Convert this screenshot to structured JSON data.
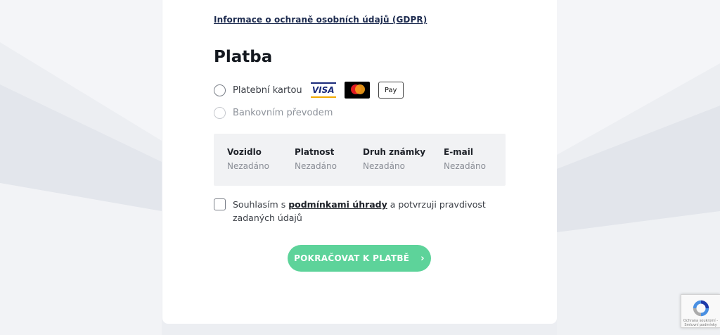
{
  "gdpr_link": "Informace o ochraně osobních údajů (GDPR)",
  "payment": {
    "title": "Platba",
    "options": [
      {
        "label": "Platební kartou",
        "selected": false,
        "logos": [
          "visa-logo",
          "mastercard-logo",
          "apple-pay-logo"
        ]
      },
      {
        "label": "Bankovním převodem",
        "selected": false,
        "disabled": true
      }
    ],
    "apple_pay_text": " Pay",
    "visa_text": "VISA"
  },
  "summary": [
    {
      "label": "Vozidlo",
      "value": "Nezadáno"
    },
    {
      "label": "Platnost",
      "value": "Nezadáno"
    },
    {
      "label": "Druh známky",
      "value": "Nezadáno"
    },
    {
      "label": "E-mail",
      "value": "Nezadáno"
    }
  ],
  "agreement": {
    "checked": false,
    "text_before": "Souhlasím s ",
    "link_text": "podmínkami úhrady",
    "text_after": " a potvrzuji pravdivost zadaných údajů"
  },
  "continue_button": {
    "label": "POKRAČOVAT K PLATBĚ",
    "chevron": "›"
  },
  "recaptcha": {
    "text": "Ochrana soukromí - Smluvní podmínky"
  },
  "colors": {
    "accent": "#5dd39a",
    "link": "#1d2b4f"
  }
}
